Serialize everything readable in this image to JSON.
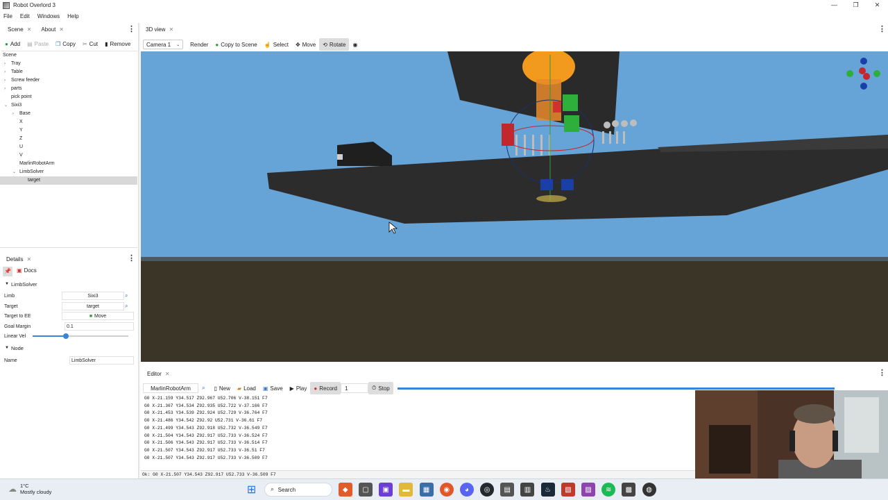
{
  "window": {
    "title": "Robot Overlord 3",
    "controls": [
      "—",
      "❐",
      "✕"
    ]
  },
  "menu": [
    "File",
    "Edit",
    "Windows",
    "Help"
  ],
  "scene_panel": {
    "tabs": [
      {
        "label": "Scene"
      },
      {
        "label": "About"
      }
    ],
    "toolbar": {
      "add": "Add",
      "paste": "Paste",
      "copy": "Copy",
      "cut": "Cut",
      "remove": "Remove"
    },
    "tree": [
      {
        "label": "Scene",
        "depth": 0,
        "expanded": true
      },
      {
        "label": "Tray",
        "depth": 1,
        "expanded": false
      },
      {
        "label": "Table",
        "depth": 1,
        "expanded": false
      },
      {
        "label": "Screw feeder",
        "depth": 1,
        "expanded": false
      },
      {
        "label": "parts",
        "depth": 1,
        "expanded": false
      },
      {
        "label": "pick point",
        "depth": 1
      },
      {
        "label": "Sixi3",
        "depth": 1,
        "expanded": true
      },
      {
        "label": "Base",
        "depth": 2,
        "expanded": false
      },
      {
        "label": "X",
        "depth": 2
      },
      {
        "label": "Y",
        "depth": 2
      },
      {
        "label": "Z",
        "depth": 2
      },
      {
        "label": "U",
        "depth": 2
      },
      {
        "label": "V",
        "depth": 2
      },
      {
        "label": "MarlinRobotArm",
        "depth": 2
      },
      {
        "label": "LimbSolver",
        "depth": 2,
        "expanded": true
      },
      {
        "label": "target",
        "depth": 3,
        "selected": true
      }
    ]
  },
  "details_panel": {
    "tab": "Details",
    "docs_label": "Docs",
    "section1": "LimbSolver",
    "limb": {
      "label": "Limb",
      "value": "Sixi3"
    },
    "target": {
      "label": "Target",
      "value": "target"
    },
    "target_to_ee": {
      "label": "Target to EE",
      "button": "Move"
    },
    "goal_margin": {
      "label": "Goal Margin",
      "value": "0.1"
    },
    "linear_vel": {
      "label": "Linear Vel",
      "slider_fraction": 0.35
    },
    "section2": "Node",
    "name": {
      "label": "Name",
      "value": "LimbSolver"
    }
  },
  "view3d": {
    "tab": "3D view",
    "camera": "Camera 1",
    "buttons": {
      "render": "Render",
      "copy_to_scene": "Copy to Scene",
      "select": "Select",
      "move": "Move",
      "rotate": "Rotate"
    },
    "active_tool": "Rotate",
    "colors": {
      "sky": "#66a3d6",
      "ground": "#3b3527",
      "platform": "#2c2c2c",
      "robot_orange": "#f29a1e"
    }
  },
  "editor_panel": {
    "tab": "Editor",
    "robot": "MarlinRobotArm",
    "buttons": {
      "new": "New",
      "load": "Load",
      "save": "Save",
      "play": "Play",
      "record": "Record",
      "stop": "Stop"
    },
    "record_count": "1",
    "log": [
      "G0 X-21.159 Y34.517 Z92.967 U52.706 V-38.151 F7",
      "G0 X-21.367 Y34.534 Z92.935 U52.722 V-37.166 F7",
      "G0 X-21.453 Y34.539 Z92.924 U52.729 V-36.764 F7",
      "G0 X-21.486 Y34.542 Z92.92 U52.731 V-36.61 F7",
      "G0 X-21.499 Y34.543 Z92.918 U52.732 V-36.549 F7",
      "G0 X-21.504 Y34.543 Z92.917 U52.733 V-36.524 F7",
      "G0 X-21.506 Y34.543 Z92.917 U52.733 V-36.514 F7",
      "G0 X-21.507 Y34.543 Z92.917 U52.733 V-36.51 F7",
      "G0 X-21.507 Y34.543 Z92.917 U52.733 V-36.509 F7"
    ],
    "status": "Ok: G0 X-21.507 Y34.543 Z92.917 U52.733 V-36.509 F7"
  },
  "taskbar": {
    "weather_temp": "1°C",
    "weather_desc": "Mostly cloudy",
    "search": "Search"
  }
}
